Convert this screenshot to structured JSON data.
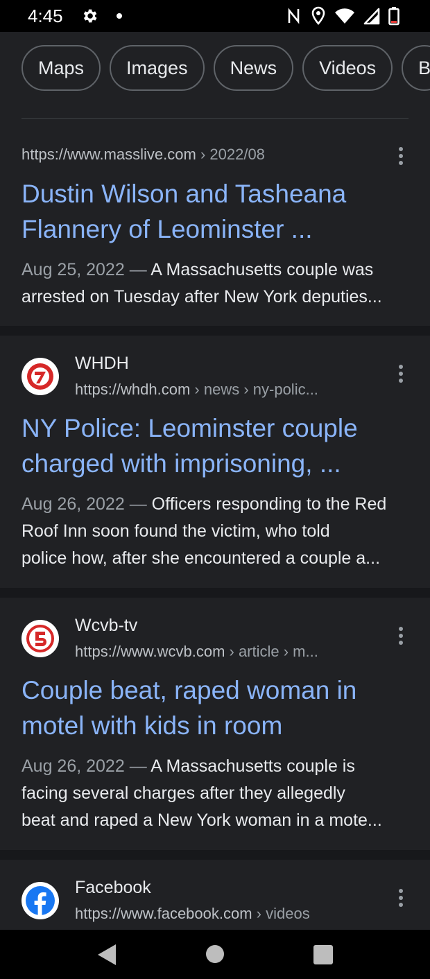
{
  "status_bar": {
    "time": "4:45",
    "icons": [
      "gear-icon",
      "notification-dot-icon",
      "nfc-icon",
      "location-icon",
      "wifi-icon",
      "signal-icon",
      "battery-icon"
    ]
  },
  "chips": [
    "Maps",
    "Images",
    "News",
    "Videos",
    "B"
  ],
  "results": [
    {
      "url": "https://www.masslive.com",
      "crumbs": " › 2022/08",
      "title_lines": [
        "Dustin Wilson and Tasheana",
        "Flannery of Leominster ..."
      ],
      "date": "Aug 25, 2022",
      "dash": " — ",
      "snippet_lines": [
        "A Massachusetts couple was",
        "arrested on Tuesday after New York deputies..."
      ]
    },
    {
      "site": "WHDH",
      "url": "https://whdh.com",
      "crumbs": " › news › ny-polic...",
      "favicon": "whdh-7-icon",
      "title_lines": [
        "NY Police: Leominster couple",
        "charged with imprisoning, ..."
      ],
      "date": "Aug 26, 2022",
      "dash": " — ",
      "snippet_lines": [
        "Officers responding to the Red",
        "Roof Inn soon found the victim, who told",
        "police how, after she encountered a couple a..."
      ]
    },
    {
      "site": "Wcvb-tv",
      "url": "https://www.wcvb.com",
      "crumbs": " › article › m...",
      "favicon": "wcvb-5-icon",
      "title_lines": [
        "Couple beat, raped woman in",
        "motel with kids in room"
      ],
      "date": "Aug 26, 2022",
      "dash": " — ",
      "snippet_lines": [
        "A Massachusetts couple is",
        "facing several charges after they allegedly",
        "beat and raped a New York woman in a mote..."
      ]
    },
    {
      "site": "Facebook",
      "url": "https://www.facebook.com",
      "crumbs": " › videos",
      "favicon": "facebook-icon"
    }
  ],
  "colors": {
    "background": "#17181b",
    "card": "#202124",
    "link": "#8ab4f8",
    "text": "#e8eaed",
    "muted": "#9aa0a6"
  }
}
